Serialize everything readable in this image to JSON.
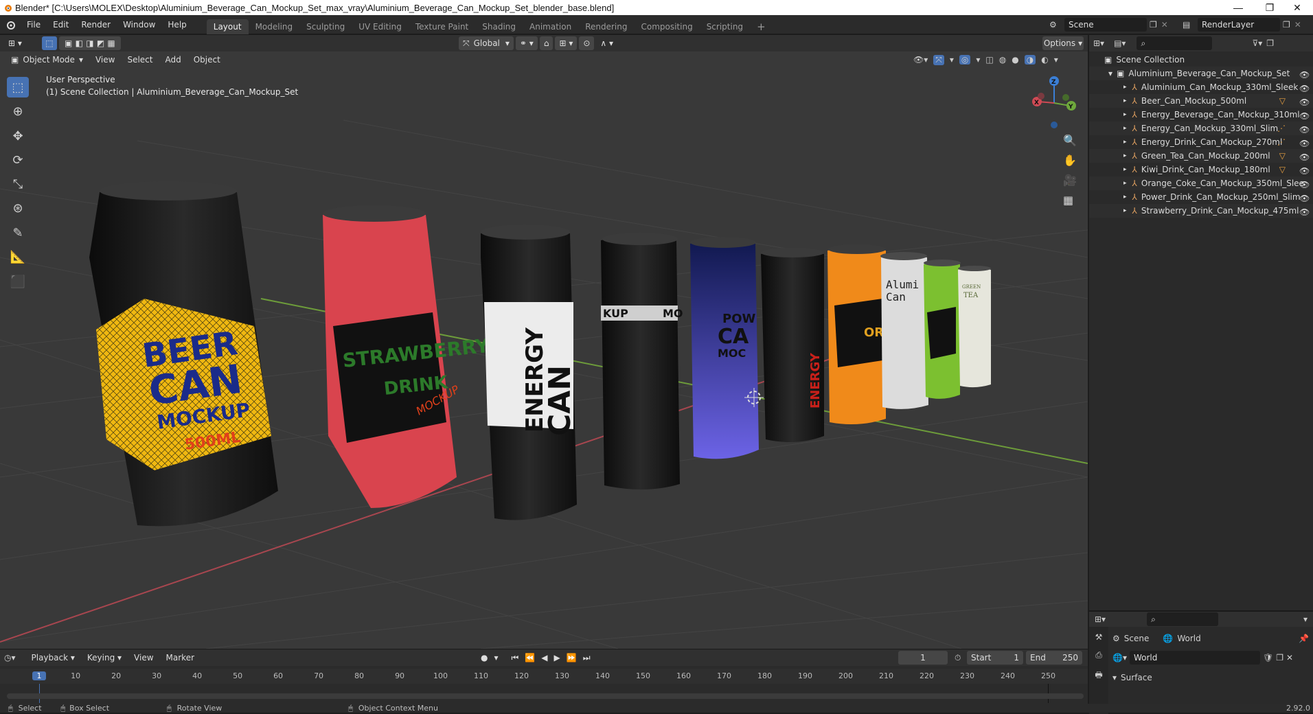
{
  "window": {
    "title": "Blender* [C:\\Users\\MOLEX\\Desktop\\Aluminium_Beverage_Can_Mockup_Set_max_vray\\Aluminium_Beverage_Can_Mockup_Set_blender_base.blend]",
    "controls": [
      "—",
      "❐",
      "✕"
    ]
  },
  "menu": [
    "File",
    "Edit",
    "Render",
    "Window",
    "Help"
  ],
  "workspaces": [
    "Layout",
    "Modeling",
    "Sculpting",
    "UV Editing",
    "Texture Paint",
    "Shading",
    "Animation",
    "Rendering",
    "Compositing",
    "Scripting"
  ],
  "active_workspace": "Layout",
  "scene_field": "Scene",
  "renderlayer_field": "RenderLayer",
  "viewport_header": {
    "transform_orientation": "Global",
    "options_label": "Options"
  },
  "viewport_menu": {
    "mode": "Object Mode",
    "items": [
      "View",
      "Select",
      "Add",
      "Object"
    ]
  },
  "viewport_info": {
    "perspective": "User Perspective",
    "collection": "(1) Scene Collection | Aluminium_Beverage_Can_Mockup_Set"
  },
  "gizmo": {
    "x": "X",
    "y": "Y",
    "z": "Z"
  },
  "outliner": {
    "root": "Scene Collection",
    "collection": "Aluminium_Beverage_Can_Mockup_Set",
    "items": [
      "Aluminium_Can_Mockup_330ml_Sleek",
      "Beer_Can_Mockup_500ml",
      "Energy_Beverage_Can_Mockup_310ml",
      "Energy_Can_Mockup_330ml_Slim",
      "Energy_Drink_Can_Mockup_270ml",
      "Green_Tea_Can_Mockup_200ml",
      "Kiwi_Drink_Can_Mockup_180ml",
      "Orange_Coke_Can_Mockup_350ml_Slee",
      "Power_Drink_Can_Mockup_250ml_Slim",
      "Strawberry_Drink_Can_Mockup_475ml"
    ]
  },
  "properties": {
    "scene_label": "Scene",
    "world_label": "World",
    "world_field": "World",
    "surface_label": "Surface"
  },
  "timeline": {
    "menu": [
      "Playback",
      "Keying",
      "View",
      "Marker"
    ],
    "current_frame": "1",
    "start_label": "Start",
    "start_value": "1",
    "end_label": "End",
    "end_value": "250",
    "ticks": [
      "1",
      "10",
      "20",
      "30",
      "40",
      "50",
      "60",
      "70",
      "80",
      "90",
      "100",
      "110",
      "120",
      "130",
      "140",
      "150",
      "160",
      "170",
      "180",
      "190",
      "200",
      "210",
      "220",
      "230",
      "240",
      "250"
    ]
  },
  "statusbar": {
    "select": "Select",
    "box_select": "Box Select",
    "rotate": "Rotate View",
    "context": "Object Context Menu",
    "version": "2.92.0"
  },
  "cans": {
    "beer": [
      "BEER",
      "CAN",
      "MOCKUP",
      "500ML"
    ],
    "strawberry": [
      "STRAWBERRY",
      "DRINK",
      "MOCKUP"
    ],
    "energy": [
      "ENERGY",
      "CAN"
    ],
    "slim": [
      "KUP",
      "MO"
    ],
    "power": [
      "POW",
      "CA",
      "MOC"
    ],
    "energy_small": "ENERGY",
    "orange": "ORA",
    "aluminium": [
      "Alumi",
      "Can"
    ],
    "tea": [
      "GREEN",
      "TEA"
    ]
  },
  "colors": {
    "accent": "#4772b3",
    "viewport_bg": "#393939",
    "grid": "#444444",
    "axis_red": "#a8464f",
    "axis_green": "#6d9c3a"
  }
}
